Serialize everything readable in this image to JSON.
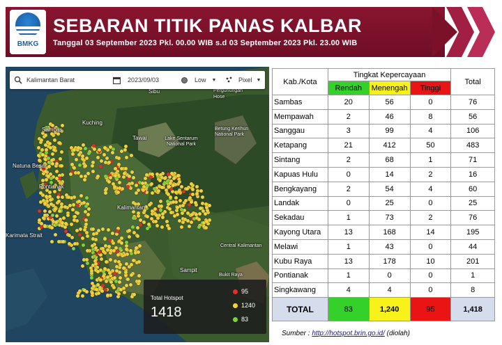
{
  "header": {
    "logo_text": "BMKG",
    "title": "SEBARAN TITIK PANAS KALBAR",
    "subtitle": "Tanggal  03 September  2023 Pkl.  00.00 WIB s.d 03 September  2023 Pkl.  23.00  WIB"
  },
  "map": {
    "search_value": "Kalimantan Barat",
    "date_value": "2023/09/03",
    "confidence_value": "Low",
    "display_value": "Pixel",
    "labels": [
      "Sibu",
      "Pergunungan Hose",
      "Kuching",
      "Tawai",
      "Lake Sentarum National Park",
      "Betung Kerihun National Park",
      "Sambas",
      "Natuna Besar",
      "Pontianak",
      "Kalimantan",
      "Karimata Strait",
      "Central Kalimantan",
      "Sampit",
      "Bukit Raya"
    ],
    "legend": {
      "title": "Total Hotspot",
      "total": "1418",
      "high": "95",
      "medium": "1240",
      "low": "83"
    },
    "colors": {
      "high": "#e0302a",
      "medium": "#f2d23a",
      "low": "#7ed23a"
    }
  },
  "table": {
    "header_kab": "Kab./Kota",
    "header_tingkat": "Tingkat Kepercayaan",
    "header_total": "Total",
    "header_rendah": "Rendah",
    "header_menengah": "Menengah",
    "header_tinggi": "Tinggi",
    "rows": [
      {
        "kab": "Sambas",
        "rendah": "20",
        "menengah": "56",
        "tinggi": "0",
        "total": "76"
      },
      {
        "kab": "Mempawah",
        "rendah": "2",
        "menengah": "46",
        "tinggi": "8",
        "total": "56"
      },
      {
        "kab": "Sanggau",
        "rendah": "3",
        "menengah": "99",
        "tinggi": "4",
        "total": "106"
      },
      {
        "kab": "Ketapang",
        "rendah": "21",
        "menengah": "412",
        "tinggi": "50",
        "total": "483"
      },
      {
        "kab": "Sintang",
        "rendah": "2",
        "menengah": "68",
        "tinggi": "1",
        "total": "71"
      },
      {
        "kab": "Kapuas Hulu",
        "rendah": "0",
        "menengah": "14",
        "tinggi": "2",
        "total": "16"
      },
      {
        "kab": "Bengkayang",
        "rendah": "2",
        "menengah": "54",
        "tinggi": "4",
        "total": "60"
      },
      {
        "kab": "Landak",
        "rendah": "0",
        "menengah": "25",
        "tinggi": "0",
        "total": "25"
      },
      {
        "kab": "Sekadau",
        "rendah": "1",
        "menengah": "73",
        "tinggi": "2",
        "total": "76"
      },
      {
        "kab": "Kayong Utara",
        "rendah": "13",
        "menengah": "168",
        "tinggi": "14",
        "total": "195"
      },
      {
        "kab": "Melawi",
        "rendah": "1",
        "menengah": "43",
        "tinggi": "0",
        "total": "44"
      },
      {
        "kab": "Kubu Raya",
        "rendah": "13",
        "menengah": "178",
        "tinggi": "10",
        "total": "201"
      },
      {
        "kab": "Pontianak",
        "rendah": "1",
        "menengah": "0",
        "tinggi": "0",
        "total": "1"
      },
      {
        "kab": "Singkawang",
        "rendah": "4",
        "menengah": "4",
        "tinggi": "0",
        "total": "8"
      }
    ],
    "total": {
      "label": "TOTAL",
      "rendah": "83",
      "menengah": "1,240",
      "tinggi": "95",
      "total": "1,418"
    }
  },
  "source": {
    "prefix": "Sumber : ",
    "link": "http://hotspot.brin.go.id/",
    "suffix": "  (diolah)"
  }
}
